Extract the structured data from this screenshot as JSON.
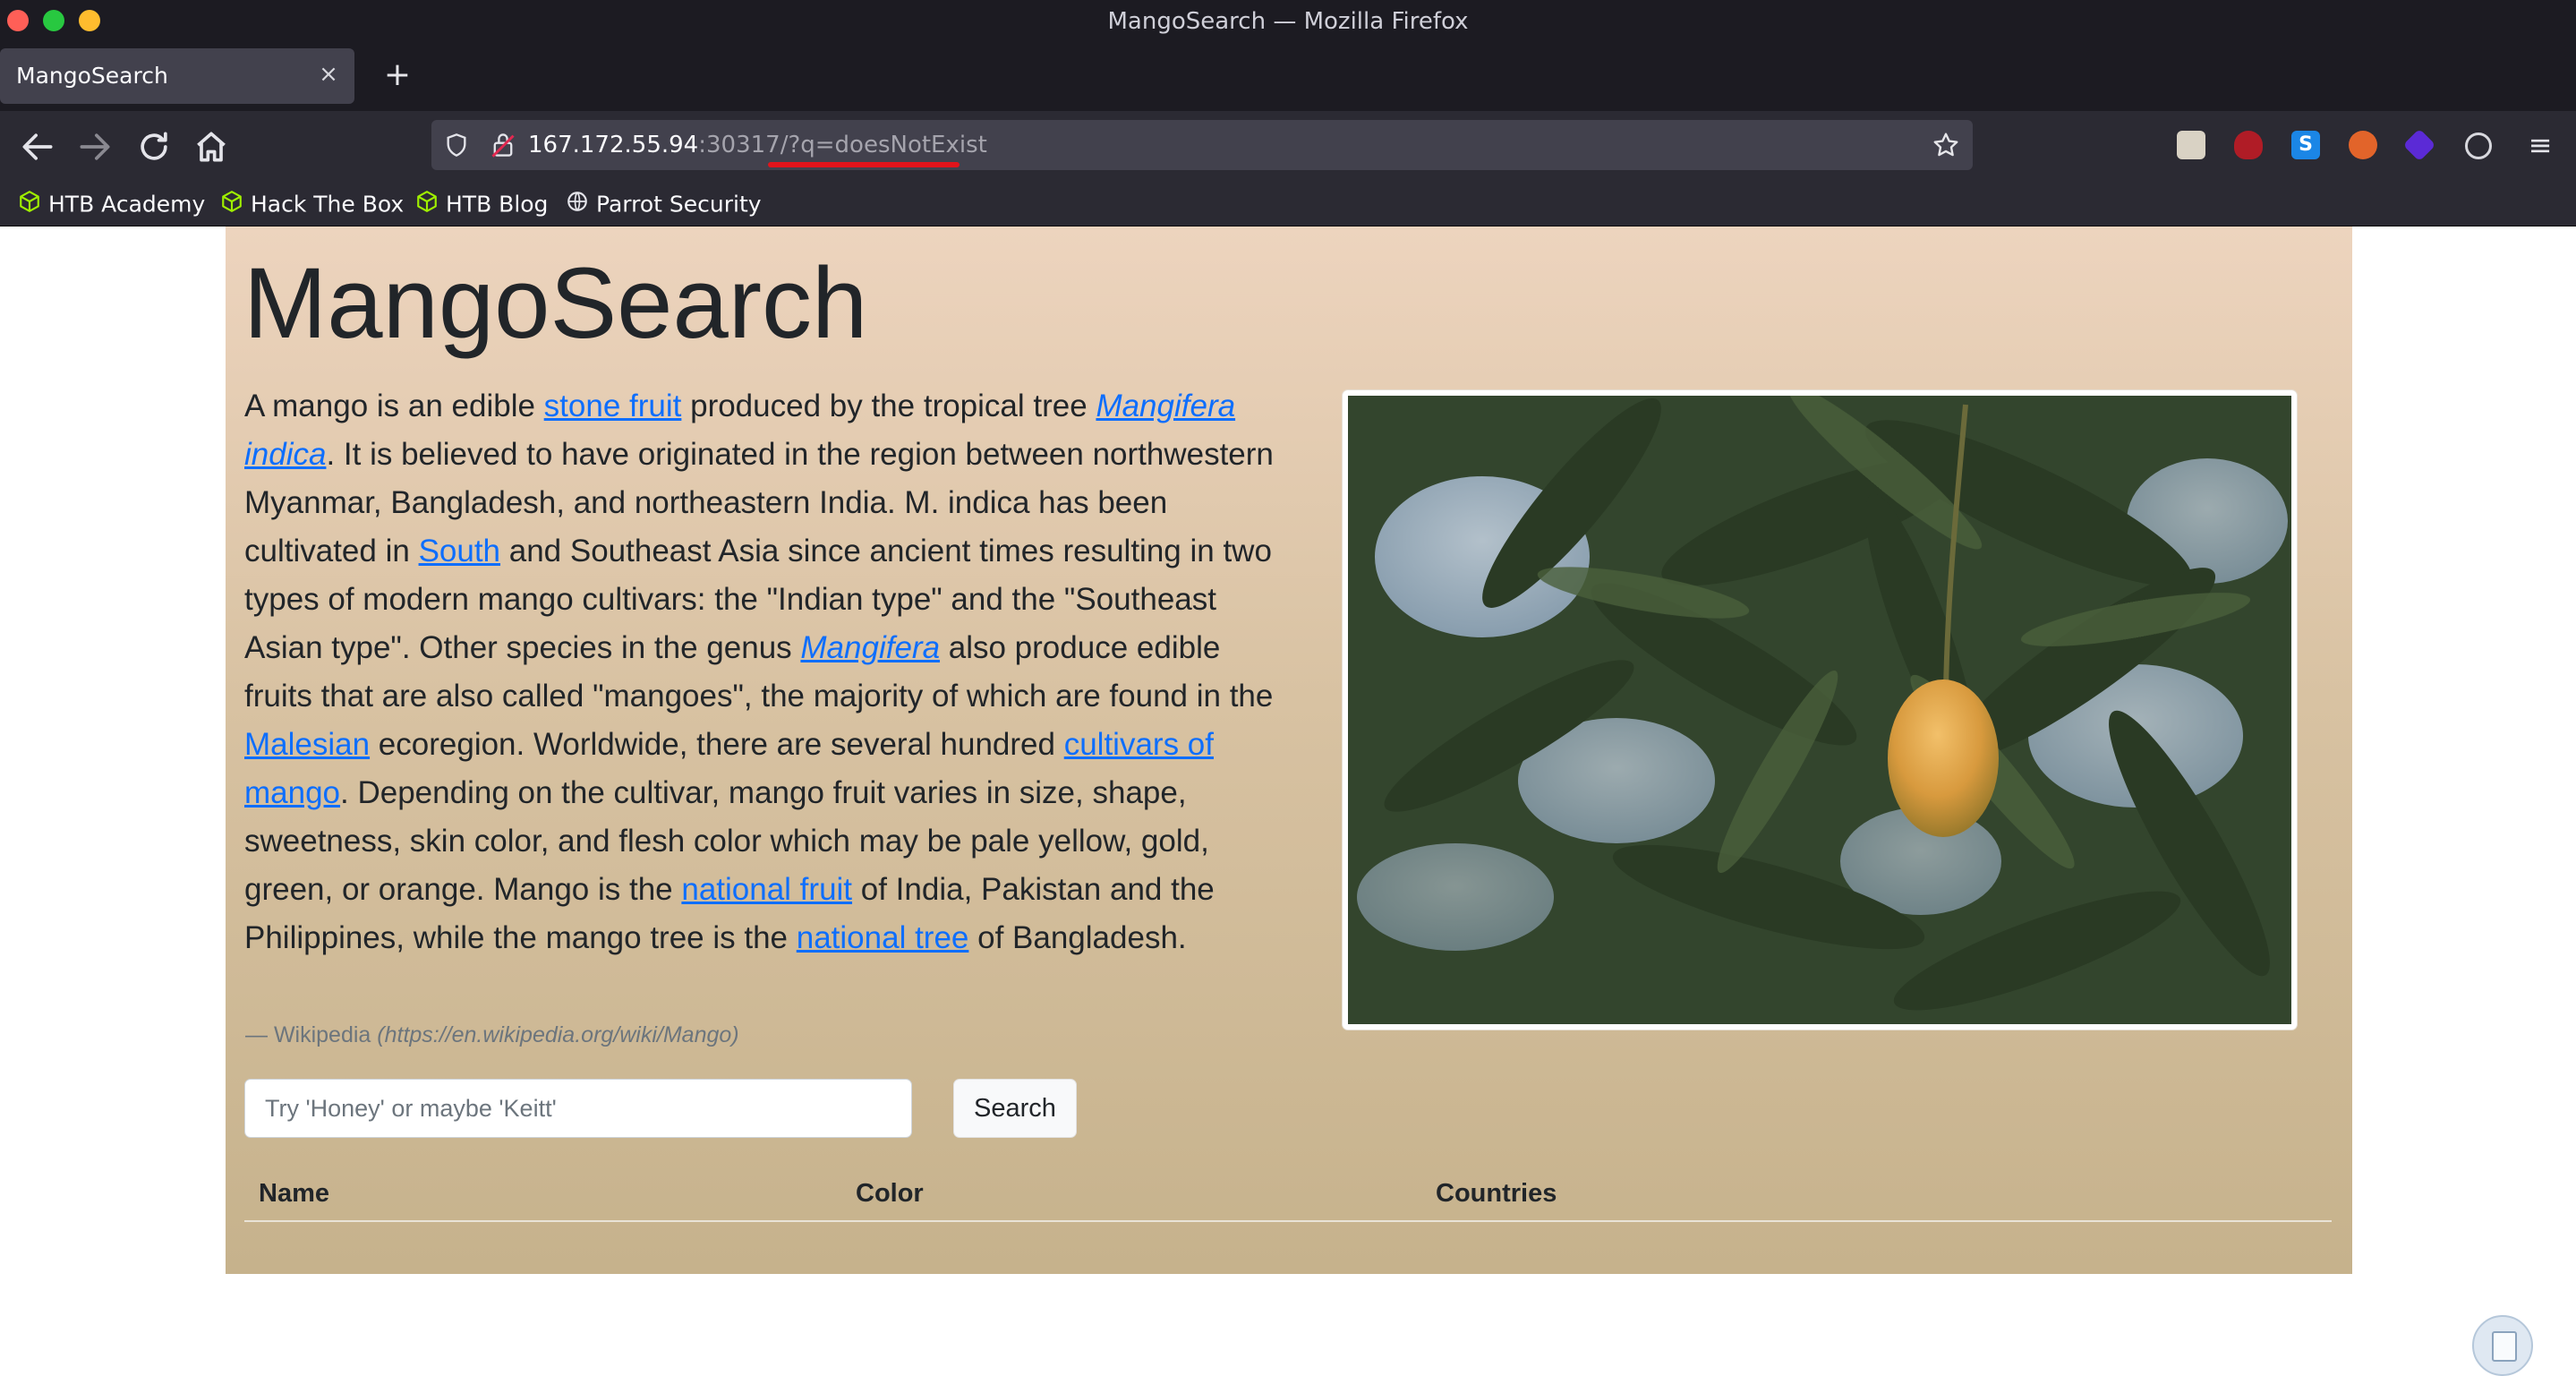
{
  "window": {
    "title": "MangoSearch — Mozilla Firefox"
  },
  "tab": {
    "title": "MangoSearch",
    "close_symbol": "×",
    "new_tab_symbol": "+"
  },
  "urlbar": {
    "host": "167.172.55.94",
    "rest": ":30317/?q=doesNotExist"
  },
  "bookmarks": [
    {
      "label": "HTB Academy",
      "icon": "htb-cube-icon"
    },
    {
      "label": "Hack The Box",
      "icon": "htb-cube-icon"
    },
    {
      "label": "HTB Blog",
      "icon": "htb-cube-icon"
    },
    {
      "label": "Parrot Security",
      "icon": "globe-icon"
    }
  ],
  "colors": {
    "link": "#0d6efd",
    "text": "#212529",
    "htb_green": "#9fef00",
    "url_underline": "#e1141b"
  },
  "page": {
    "heading": "MangoSearch",
    "desc": {
      "t1": "A mango is an edible ",
      "l1": "stone fruit",
      "t2": " produced by the tropical tree ",
      "l2": "Mangifera indica",
      "t3": ". It is believed to have originated in the region between northwestern Myanmar, Bangladesh, and northeastern India. M. indica has been cultivated in ",
      "l3": "South",
      "t4": " and Southeast Asia since ancient times resulting in two types of modern mango cultivars: the \"Indian type\" and the \"Southeast Asian type\". Other species in the genus ",
      "l4": "Mangifera",
      "t5": " also produce edible fruits that are also called \"mangoes\", the majority of which are found in the ",
      "l5": "Malesian",
      "t6": " ecoregion. Worldwide, there are several hundred ",
      "l6": "cultivars of mango",
      "t7": ". Depending on the cultivar, mango fruit varies in size, shape, sweetness, skin color, and flesh color which may be pale yellow, gold, green, or orange. Mango is the ",
      "l7": "national fruit",
      "t8": " of India, Pakistan and the Philippines, while the mango tree is the ",
      "l8": "national tree",
      "t9": " of Bangladesh."
    },
    "citation": {
      "prefix": "— Wikipedia ",
      "source": "(https://en.wikipedia.org/wiki/Mango)"
    },
    "search": {
      "placeholder": "Try 'Honey' or maybe 'Keitt'",
      "value": "",
      "button": "Search"
    },
    "table": {
      "columns": [
        "Name",
        "Color",
        "Countries"
      ],
      "rows": []
    }
  }
}
